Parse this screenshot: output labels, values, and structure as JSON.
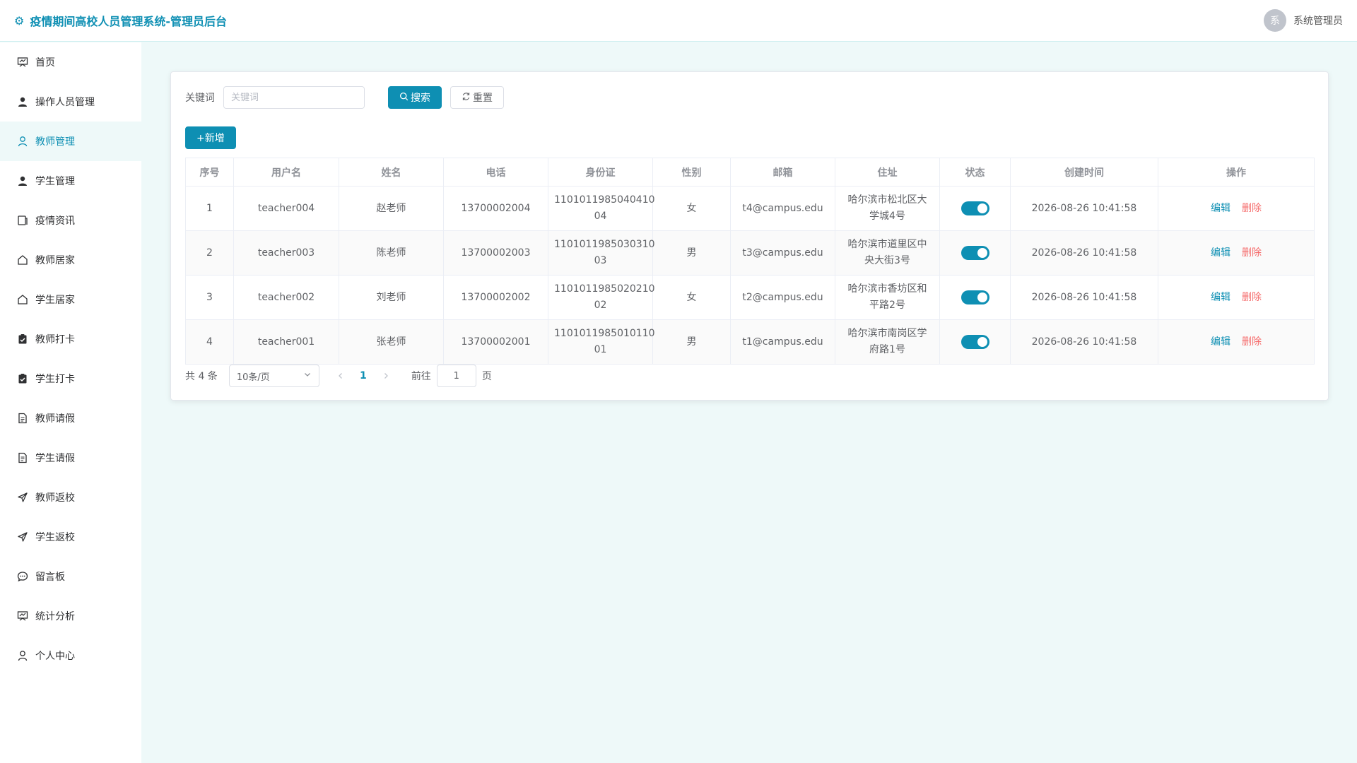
{
  "header": {
    "title": "疫情期间高校人员管理系统-管理员后台",
    "avatar_text": "系",
    "user_name": "系统管理员"
  },
  "sidebar": {
    "items": [
      {
        "label": "首页",
        "icon": "dashboard-icon"
      },
      {
        "label": "操作人员管理",
        "icon": "user-filled-icon"
      },
      {
        "label": "教师管理",
        "icon": "user-outline-icon",
        "active": true
      },
      {
        "label": "学生管理",
        "icon": "user-filled-icon"
      },
      {
        "label": "疫情资讯",
        "icon": "news-icon"
      },
      {
        "label": "教师居家",
        "icon": "home-icon"
      },
      {
        "label": "学生居家",
        "icon": "home-icon"
      },
      {
        "label": "教师打卡",
        "icon": "clipboard-check-icon"
      },
      {
        "label": "学生打卡",
        "icon": "clipboard-check-icon"
      },
      {
        "label": "教师请假",
        "icon": "document-icon"
      },
      {
        "label": "学生请假",
        "icon": "document-icon"
      },
      {
        "label": "教师返校",
        "icon": "send-icon"
      },
      {
        "label": "学生返校",
        "icon": "send-icon"
      },
      {
        "label": "留言板",
        "icon": "chat-icon"
      },
      {
        "label": "统计分析",
        "icon": "chart-icon"
      },
      {
        "label": "个人中心",
        "icon": "user-outline-icon"
      }
    ]
  },
  "search": {
    "label": "关键词",
    "placeholder": "关键词",
    "search_label": "搜索",
    "reset_label": "重置"
  },
  "toolbar": {
    "add_label": "+新增"
  },
  "table": {
    "columns": [
      "序号",
      "用户名",
      "姓名",
      "电话",
      "身份证",
      "性别",
      "邮箱",
      "住址",
      "状态",
      "创建时间",
      "操作"
    ],
    "rows": [
      {
        "index": "1",
        "username": "teacher004",
        "name": "赵老师",
        "phone": "13700002004",
        "id_card_1": "1101011985040410",
        "id_card_2": "04",
        "gender": "女",
        "email": "t4@campus.edu",
        "addr_1": "哈尔滨市松北区大",
        "addr_2": "学城4号",
        "enabled": true,
        "created": "2026-08-26 10:41:58"
      },
      {
        "index": "2",
        "username": "teacher003",
        "name": "陈老师",
        "phone": "13700002003",
        "id_card_1": "1101011985030310",
        "id_card_2": "03",
        "gender": "男",
        "email": "t3@campus.edu",
        "addr_1": "哈尔滨市道里区中",
        "addr_2": "央大街3号",
        "enabled": true,
        "created": "2026-08-26 10:41:58"
      },
      {
        "index": "3",
        "username": "teacher002",
        "name": "刘老师",
        "phone": "13700002002",
        "id_card_1": "1101011985020210",
        "id_card_2": "02",
        "gender": "女",
        "email": "t2@campus.edu",
        "addr_1": "哈尔滨市香坊区和",
        "addr_2": "平路2号",
        "enabled": true,
        "created": "2026-08-26 10:41:58"
      },
      {
        "index": "4",
        "username": "teacher001",
        "name": "张老师",
        "phone": "13700002001",
        "id_card_1": "1101011985010110",
        "id_card_2": "01",
        "gender": "男",
        "email": "t1@campus.edu",
        "addr_1": "哈尔滨市南岗区学",
        "addr_2": "府路1号",
        "enabled": true,
        "created": "2026-08-26 10:41:58"
      }
    ],
    "edit_label": "编辑",
    "delete_label": "删除"
  },
  "pagination": {
    "total_text": "共 4 条",
    "page_size": "10条/页",
    "current_page": "1",
    "goto_prefix": "前往",
    "goto_value": "1",
    "goto_suffix": "页"
  },
  "colors": {
    "primary": "#0e8fb3",
    "danger": "#f56c6c",
    "background": "#eef9f9"
  }
}
